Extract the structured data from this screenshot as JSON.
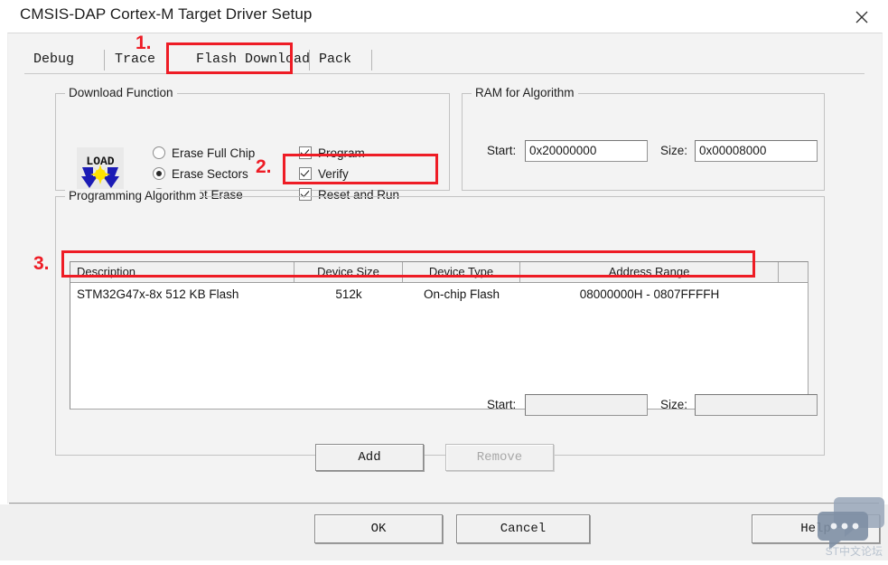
{
  "window": {
    "title": "CMSIS-DAP Cortex-M Target Driver Setup",
    "close_icon": "close-icon"
  },
  "tabs": [
    {
      "label": "Debug",
      "selected": false
    },
    {
      "label": "Trace",
      "selected": false
    },
    {
      "label": "Flash Download",
      "selected": true
    },
    {
      "label": "Pack",
      "selected": false
    }
  ],
  "download_function": {
    "legend": "Download Function",
    "icon_label": "LOAD",
    "radios": [
      {
        "label": "Erase Full Chip",
        "checked": false
      },
      {
        "label": "Erase Sectors",
        "checked": true
      },
      {
        "label": "Do not Erase",
        "checked": false
      }
    ],
    "checks": [
      {
        "label": "Program",
        "checked": true
      },
      {
        "label": "Verify",
        "checked": true
      },
      {
        "label": "Reset and Run",
        "checked": true
      }
    ]
  },
  "ram_for_algorithm": {
    "legend": "RAM for Algorithm",
    "start_label": "Start:",
    "start_value": "0x20000000",
    "size_label": "Size:",
    "size_value": "0x00008000"
  },
  "programming_algorithm": {
    "legend": "Programming Algorithm",
    "columns": [
      "Description",
      "Device Size",
      "Device Type",
      "Address Range",
      ""
    ],
    "rows": [
      {
        "description": "STM32G47x-8x 512 KB Flash",
        "device_size": "512k",
        "device_type": "On-chip Flash",
        "address_range": "08000000H - 0807FFFFH",
        "extra": ""
      }
    ],
    "range_start_label": "Start:",
    "range_start_value": "",
    "range_size_label": "Size:",
    "range_size_value": "",
    "add_label": "Add",
    "remove_label": "Remove",
    "remove_disabled": true
  },
  "footer": {
    "ok_label": "OK",
    "cancel_label": "Cancel",
    "help_label": "Help"
  },
  "annotations": [
    {
      "num": "1.",
      "target": "flash-download-tab"
    },
    {
      "num": "2.",
      "target": "reset-and-run-checkbox"
    },
    {
      "num": "3.",
      "target": "algorithm-row"
    }
  ],
  "watermark": {
    "text": "ST中文论坛",
    "accent_color": "#ee1c25"
  }
}
